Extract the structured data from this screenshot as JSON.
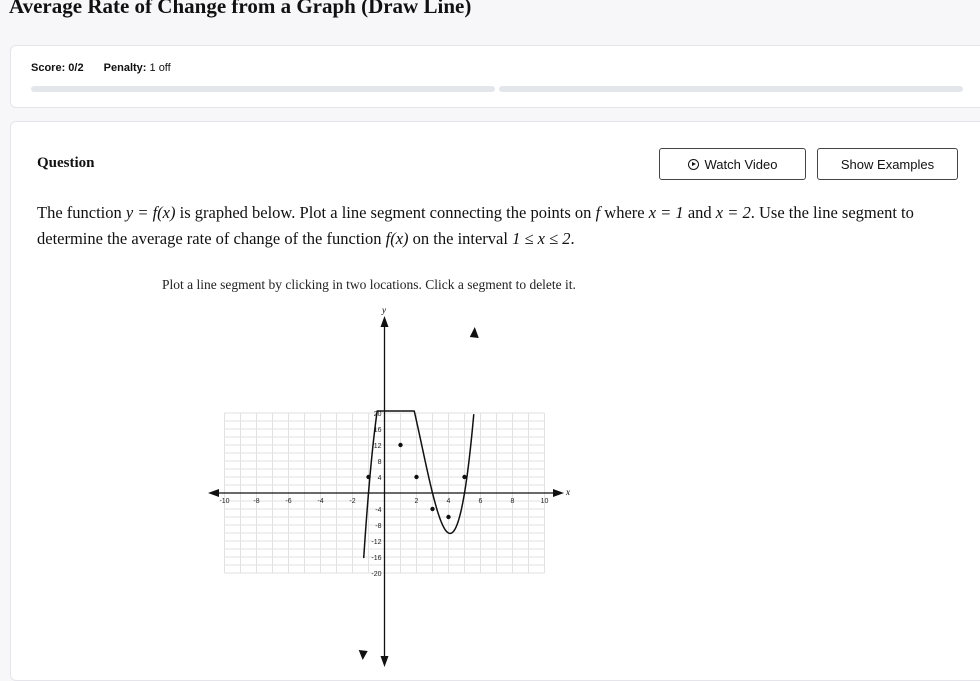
{
  "page": {
    "title": "Average Rate of Change from a Graph (Draw Line)"
  },
  "score": {
    "score_label": "Score: 0/2",
    "penalty_label": "Penalty:",
    "penalty_value": "1 off"
  },
  "question": {
    "label": "Question",
    "watch_video_label": "Watch Video",
    "show_examples_label": "Show Examples",
    "text_parts": [
      "The function ",
      "y = f(x)",
      " is graphed below. Plot a line segment connecting the points on ",
      "f",
      " where ",
      "x = 1",
      " and ",
      "x = 2",
      ". Use the line segment to determine the average rate of change of the function ",
      "f(x)",
      " on the interval ",
      "1 ≤ x ≤ 2",
      "."
    ],
    "instruction": "Plot a line segment by clicking in two locations. Click a segment to delete it."
  },
  "graph": {
    "x_axis_label": "x",
    "y_axis_label": "y",
    "x_range": [
      -10,
      10
    ],
    "y_range": [
      -20,
      20
    ],
    "x_ticks": [
      -10,
      -8,
      -6,
      -4,
      -2,
      2,
      4,
      6,
      8,
      10
    ],
    "y_ticks": [
      20,
      16,
      12,
      8,
      4,
      -4,
      -8,
      -12,
      -16,
      -20
    ],
    "x_tick_labels": [
      "-10",
      "-8",
      "-6",
      "-4",
      "-2",
      "2",
      "4",
      "6",
      "8",
      "10"
    ],
    "y_tick_labels": [
      "20",
      "16",
      "12",
      "8",
      "4",
      "-4",
      "-8",
      "-12",
      "-16",
      "-20"
    ],
    "grid": true,
    "function": "y = 2(x + 1)(x - 3)(x - 5)",
    "marked_points": [
      [
        -1,
        4
      ],
      [
        1,
        12
      ],
      [
        2,
        4
      ],
      [
        3,
        -4
      ],
      [
        4,
        -6
      ],
      [
        5,
        4
      ]
    ]
  }
}
